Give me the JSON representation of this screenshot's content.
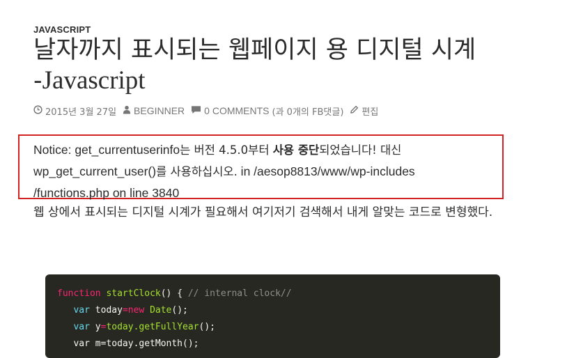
{
  "post": {
    "category": "JAVASCRIPT",
    "title_ko": "날자까지 표시되는 웹페이지 용 디지털 시계",
    "title_dash": "-",
    "title_latin": "Javascript",
    "meta": {
      "date": "2015년 3월 27일",
      "author": "BEGINNER",
      "comments": "0 COMMENTS",
      "fb_comments": "(과 0개의 FB댓글)",
      "edit": "편집",
      "icons": [
        "clock-icon",
        "user-icon",
        "comment-icon",
        "pencil-icon"
      ]
    },
    "notice": {
      "part1": "Notice: get_currentuserinfo",
      "part2": "는 버전 4.5.0부터 ",
      "part3": "사용 중단",
      "part4": "되었습니다! 대신",
      "part5": "wp_get_current_user()",
      "part6": "를 사용하십시오.",
      "part7": " in /aesop8813/www/wp-includes",
      "part8": "/functions.php on line 3840",
      "border_color": "#d32222"
    },
    "body": "웹 상에서 표시되는 디지털 시계가 필요해서 여기저기 검색해서 내게 알맞는 코드로 변형했다.",
    "code": {
      "l1_kw": "function",
      "l1_fn": " startClock",
      "l1_pl": "() { ",
      "l1_cm": "// internal clock//",
      "l2_ind": "   ",
      "l2_vr": "var",
      "l2_pl1": " today",
      "l2_kw1": "=",
      "l2_kw2": "new",
      "l2_fn": " Date",
      "l2_pl2": "();",
      "l3_ind": "   ",
      "l3_vr": "var",
      "l3_pl1": " y",
      "l3_kw": "=",
      "l3_fn": "today.getFullYear",
      "l3_pl2": "();",
      "l4_text": "   var m=today.getMonth();"
    },
    "colors": {
      "text": "#2b2b2b",
      "meta": "#767676",
      "code_bg": "#272822",
      "keyword": "#f92672",
      "function": "#a6e22e",
      "comment": "#8f908a",
      "variable": "#66d9ef"
    }
  }
}
